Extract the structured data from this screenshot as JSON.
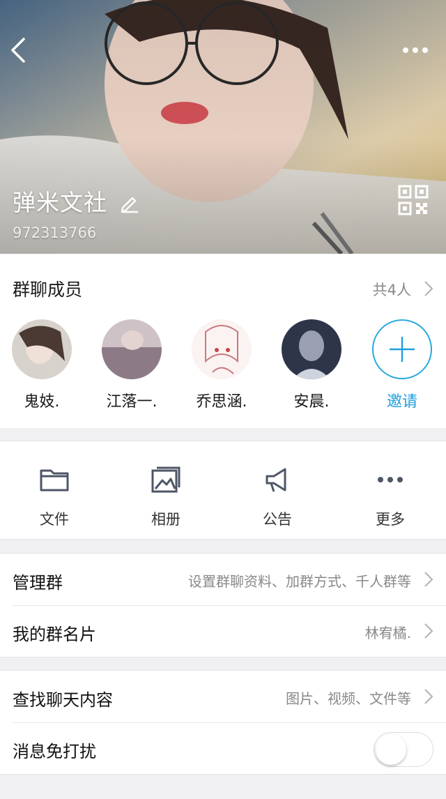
{
  "header": {
    "group_name": "弹米文社",
    "group_id": "972313766"
  },
  "members": {
    "title": "群聊成员",
    "count": "共4人",
    "list": [
      {
        "name": "鬼妓."
      },
      {
        "name": "江落一."
      },
      {
        "name": "乔思涵."
      },
      {
        "name": "安晨."
      }
    ],
    "invite_label": "邀请"
  },
  "actions": [
    {
      "label": "文件",
      "icon": "folder-icon"
    },
    {
      "label": "相册",
      "icon": "album-icon"
    },
    {
      "label": "公告",
      "icon": "megaphone-icon"
    },
    {
      "label": "更多",
      "icon": "more-icon"
    }
  ],
  "settings": {
    "manage": {
      "title": "管理群",
      "value": "设置群聊资料、加群方式、千人群等"
    },
    "card": {
      "title": "我的群名片",
      "value": "林宥橘."
    },
    "search": {
      "title": "查找聊天内容",
      "value": "图片、视频、文件等"
    },
    "mute": {
      "title": "消息免打扰",
      "enabled": false
    }
  },
  "colors": {
    "accent": "#1e9fdf"
  }
}
